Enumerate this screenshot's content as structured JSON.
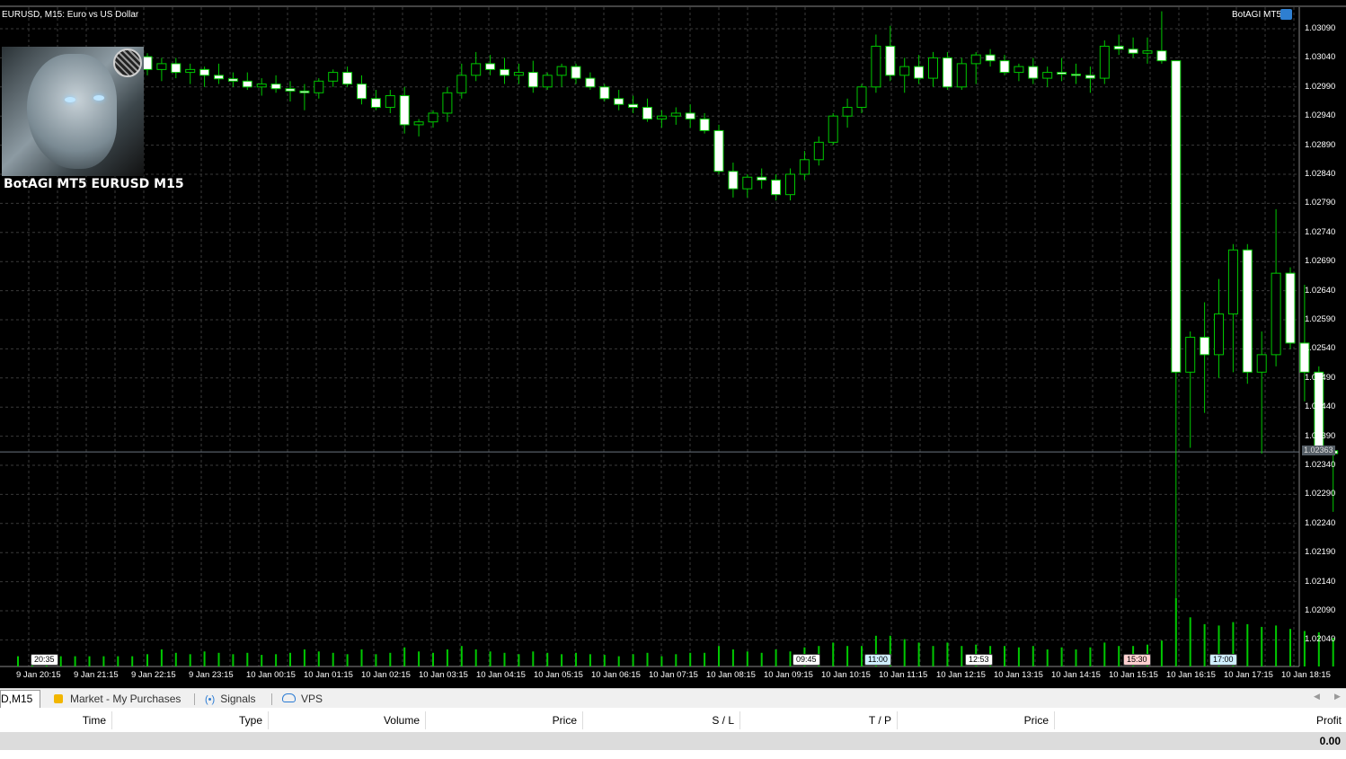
{
  "chart": {
    "symbol_title": "EURUSD, M15:  Euro vs US Dollar",
    "ea_name": "BotAGI MT5",
    "logo_caption": "BotAGI MT5 EURUSD M15",
    "current_price": "1.02363",
    "colors": {
      "background": "#000000",
      "grid": "#3a3a3a",
      "candle_up": "#000000",
      "candle_down": "#ffffff",
      "wick": "#00c800",
      "volume": "#00c800",
      "axis_text": "#ffffff"
    },
    "price_ticks": [
      "1.03090",
      "1.03040",
      "1.02990",
      "1.02940",
      "1.02890",
      "1.02840",
      "1.02790",
      "1.02740",
      "1.02690",
      "1.02640",
      "1.02590",
      "1.02540",
      "1.02490",
      "1.02440",
      "1.02390",
      "1.02340",
      "1.02290",
      "1.02240",
      "1.02190",
      "1.02140",
      "1.02090",
      "1.02040"
    ],
    "time_ticks": [
      "9 Jan 20:15",
      "9 Jan 21:15",
      "9 Jan 22:15",
      "9 Jan 23:15",
      "10 Jan 00:15",
      "10 Jan 01:15",
      "10 Jan 02:15",
      "10 Jan 03:15",
      "10 Jan 04:15",
      "10 Jan 05:15",
      "10 Jan 06:15",
      "10 Jan 07:15",
      "10 Jan 08:15",
      "10 Jan 09:15",
      "10 Jan 10:15",
      "10 Jan 11:15",
      "10 Jan 12:15",
      "10 Jan 13:15",
      "10 Jan 14:15",
      "10 Jan 15:15",
      "10 Jan 16:15",
      "10 Jan 17:15",
      "10 Jan 18:15"
    ],
    "time_labels": [
      "20:35",
      "09:45",
      "11:00",
      "12:53",
      "15:30",
      "17:00"
    ]
  },
  "chart_data": {
    "type": "candlestick",
    "ylim": [
      1.02,
      1.0313
    ],
    "start_time": "9 Jan 20:15",
    "interval_minutes": 15,
    "ohlc": [
      [
        1.03042,
        1.03048,
        1.0301,
        1.0302
      ],
      [
        1.0302,
        1.0304,
        1.03,
        1.0303
      ],
      [
        1.0303,
        1.0304,
        1.03005,
        1.03015
      ],
      [
        1.03015,
        1.0303,
        1.02995,
        1.0302
      ],
      [
        1.0302,
        1.03025,
        1.0299,
        1.0301
      ],
      [
        1.0301,
        1.0303,
        1.02995,
        1.03004
      ],
      [
        1.03004,
        1.03015,
        1.0299,
        1.03
      ],
      [
        1.03,
        1.03015,
        1.02985,
        1.0299
      ],
      [
        1.0299,
        1.03005,
        1.02975,
        1.02995
      ],
      [
        1.02995,
        1.0301,
        1.0298,
        1.02987
      ],
      [
        1.02987,
        1.03,
        1.02965,
        1.02983
      ],
      [
        1.02983,
        1.02995,
        1.0295,
        1.0298
      ],
      [
        1.0298,
        1.03005,
        1.0297,
        1.03
      ],
      [
        1.03,
        1.0302,
        1.0299,
        1.03015
      ],
      [
        1.03015,
        1.03025,
        1.0299,
        1.02995
      ],
      [
        1.02995,
        1.0301,
        1.0296,
        1.0297
      ],
      [
        1.0297,
        1.02985,
        1.0295,
        1.02955
      ],
      [
        1.02955,
        1.02985,
        1.02945,
        1.02975
      ],
      [
        1.02975,
        1.0299,
        1.0291,
        1.02925
      ],
      [
        1.02925,
        1.02935,
        1.02905,
        1.0293
      ],
      [
        1.0293,
        1.0295,
        1.0292,
        1.02945
      ],
      [
        1.02945,
        1.0299,
        1.0293,
        1.0298
      ],
      [
        1.0298,
        1.0303,
        1.0297,
        1.0301
      ],
      [
        1.0301,
        1.0305,
        1.03,
        1.0303
      ],
      [
        1.0303,
        1.03045,
        1.0301,
        1.0302
      ],
      [
        1.0302,
        1.0304,
        1.02995,
        1.0301
      ],
      [
        1.0301,
        1.0303,
        1.02995,
        1.03015
      ],
      [
        1.03015,
        1.03035,
        1.0298,
        1.0299
      ],
      [
        1.0299,
        1.03015,
        1.02985,
        1.0301
      ],
      [
        1.0301,
        1.0303,
        1.0299,
        1.03025
      ],
      [
        1.03025,
        1.0303,
        1.02995,
        1.03005
      ],
      [
        1.03005,
        1.03015,
        1.02985,
        1.0299
      ],
      [
        1.0299,
        1.02995,
        1.02965,
        1.0297
      ],
      [
        1.0297,
        1.02985,
        1.0295,
        1.0296
      ],
      [
        1.0296,
        1.02975,
        1.02945,
        1.02955
      ],
      [
        1.02955,
        1.0297,
        1.0293,
        1.02935
      ],
      [
        1.02935,
        1.0295,
        1.0292,
        1.0294
      ],
      [
        1.0294,
        1.02955,
        1.02925,
        1.02945
      ],
      [
        1.02945,
        1.0296,
        1.0292,
        1.02935
      ],
      [
        1.02935,
        1.02945,
        1.0291,
        1.02915
      ],
      [
        1.02915,
        1.02925,
        1.0284,
        1.02845
      ],
      [
        1.02845,
        1.0286,
        1.028,
        1.02815
      ],
      [
        1.02815,
        1.0284,
        1.028,
        1.02835
      ],
      [
        1.02835,
        1.0285,
        1.02815,
        1.0283
      ],
      [
        1.0283,
        1.0284,
        1.02795,
        1.02805
      ],
      [
        1.02805,
        1.0285,
        1.02795,
        1.0284
      ],
      [
        1.0284,
        1.0288,
        1.0283,
        1.02865
      ],
      [
        1.02865,
        1.02905,
        1.02855,
        1.02895
      ],
      [
        1.02895,
        1.02945,
        1.0289,
        1.0294
      ],
      [
        1.0294,
        1.0297,
        1.0292,
        1.02955
      ],
      [
        1.02955,
        1.02995,
        1.02945,
        1.0299
      ],
      [
        1.0299,
        1.0308,
        1.0298,
        1.0306
      ],
      [
        1.0306,
        1.03095,
        1.03,
        1.0301
      ],
      [
        1.0301,
        1.0304,
        1.0298,
        1.03025
      ],
      [
        1.03025,
        1.03045,
        1.02995,
        1.03005
      ],
      [
        1.03005,
        1.0305,
        1.0299,
        1.0304
      ],
      [
        1.0304,
        1.0305,
        1.02985,
        1.0299
      ],
      [
        1.0299,
        1.0304,
        1.02985,
        1.0303
      ],
      [
        1.0303,
        1.0305,
        1.02995,
        1.03045
      ],
      [
        1.03045,
        1.03055,
        1.03025,
        1.03035
      ],
      [
        1.03035,
        1.03045,
        1.0301,
        1.03015
      ],
      [
        1.03015,
        1.0303,
        1.03,
        1.03025
      ],
      [
        1.03025,
        1.0304,
        1.02995,
        1.03005
      ],
      [
        1.03005,
        1.03025,
        1.0299,
        1.03015
      ],
      [
        1.03015,
        1.0304,
        1.03,
        1.03012
      ],
      [
        1.03012,
        1.0303,
        1.02995,
        1.0301
      ],
      [
        1.0301,
        1.03025,
        1.0298,
        1.03005
      ],
      [
        1.03005,
        1.0307,
        1.02995,
        1.0306
      ],
      [
        1.0306,
        1.0308,
        1.03045,
        1.03055
      ],
      [
        1.03055,
        1.03075,
        1.0304,
        1.03048
      ],
      [
        1.03048,
        1.03075,
        1.0303,
        1.03052
      ],
      [
        1.03052,
        1.0312,
        1.0303,
        1.03035
      ],
      [
        1.03035,
        1.03035,
        1.021,
        1.025
      ],
      [
        1.025,
        1.0257,
        1.0237,
        1.0256
      ],
      [
        1.0256,
        1.0262,
        1.0243,
        1.0253
      ],
      [
        1.0253,
        1.0266,
        1.0249,
        1.026
      ],
      [
        1.026,
        1.0272,
        1.025,
        1.0271
      ],
      [
        1.0271,
        1.0272,
        1.0248,
        1.025
      ],
      [
        1.025,
        1.0257,
        1.0236,
        1.0253
      ],
      [
        1.0253,
        1.0278,
        1.0251,
        1.0267
      ],
      [
        1.0267,
        1.0268,
        1.0254,
        1.0255
      ],
      [
        1.0255,
        1.0265,
        1.0245,
        1.025
      ],
      [
        1.025,
        1.0251,
        1.02365,
        1.02365
      ],
      [
        1.02365,
        1.0237,
        1.0226,
        1.0236
      ]
    ],
    "volume_rel": [
      0.18,
      0.25,
      0.2,
      0.18,
      0.22,
      0.2,
      0.18,
      0.2,
      0.17,
      0.18,
      0.2,
      0.25,
      0.22,
      0.2,
      0.18,
      0.25,
      0.18,
      0.2,
      0.28,
      0.22,
      0.2,
      0.25,
      0.3,
      0.25,
      0.22,
      0.2,
      0.18,
      0.22,
      0.2,
      0.18,
      0.2,
      0.18,
      0.17,
      0.15,
      0.18,
      0.2,
      0.15,
      0.18,
      0.2,
      0.2,
      0.3,
      0.25,
      0.22,
      0.2,
      0.25,
      0.22,
      0.28,
      0.3,
      0.35,
      0.3,
      0.3,
      0.45,
      0.45,
      0.4,
      0.35,
      0.3,
      0.35,
      0.3,
      0.32,
      0.3,
      0.3,
      0.28,
      0.3,
      0.25,
      0.28,
      0.25,
      0.28,
      0.35,
      0.3,
      0.3,
      0.32,
      0.38,
      1.0,
      0.72,
      0.62,
      0.6,
      0.65,
      0.62,
      0.58,
      0.6,
      0.55,
      0.52,
      0.5,
      0.42
    ]
  },
  "toolbox": {
    "tabs": [
      {
        "label": "D,M15"
      },
      {
        "label": "Market - My Purchases",
        "icon": "lock-icon"
      },
      {
        "label": "Signals",
        "icon": "signal-icon"
      },
      {
        "label": "VPS",
        "icon": "cloud-icon"
      }
    ],
    "columns": [
      "Time",
      "Type",
      "Volume",
      "Price",
      "S / L",
      "T / P",
      "Price",
      "Profit"
    ],
    "total_profit": "0.00"
  }
}
